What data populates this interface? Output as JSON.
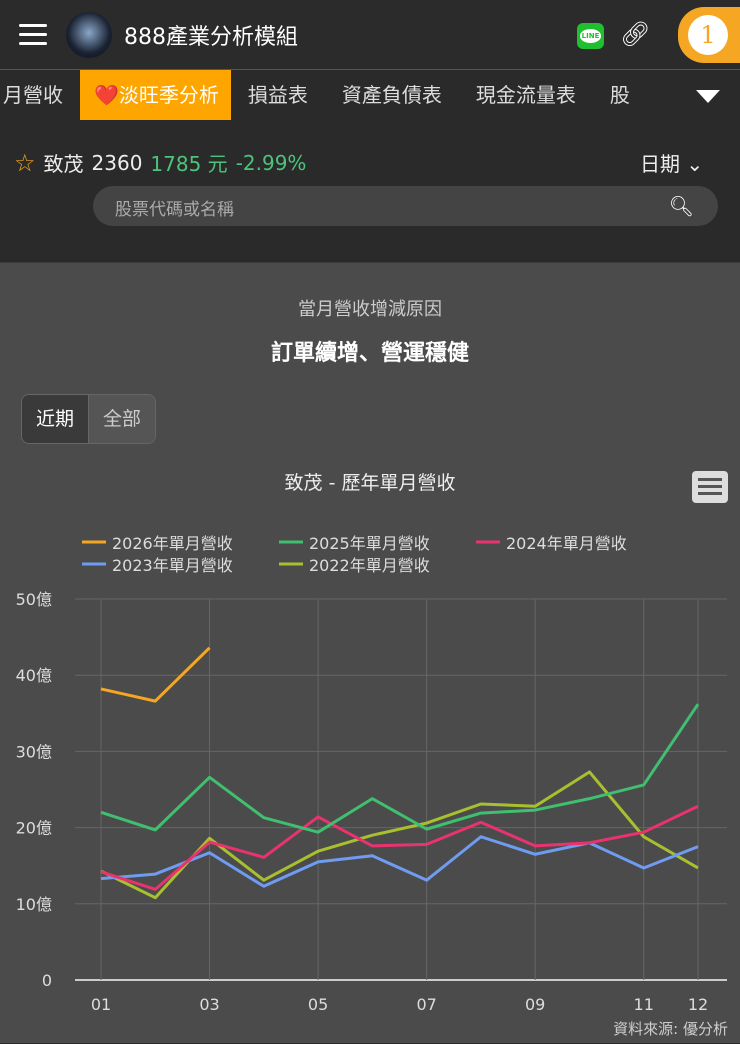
{
  "header": {
    "app_title": "888產業分析模組",
    "badge": "1",
    "line_label": "LINE"
  },
  "tabs": [
    "月營收",
    "❤️淡旺季分析",
    "損益表",
    "資產負債表",
    "現金流量表",
    "股"
  ],
  "stock": {
    "name": "致茂",
    "code": "2360",
    "price": "1785 元",
    "change": "-2.99%",
    "date_label": "日期"
  },
  "search": {
    "placeholder": "股票代碼或名稱"
  },
  "main": {
    "subtitle": "當月營收增減原因",
    "reason": "訂單續增、營運穩健",
    "toggle": [
      "近期",
      "全部"
    ],
    "source": "資料來源: 優分析"
  },
  "colors": {
    "accent": "#fea500",
    "up": "#4cc47a"
  },
  "chart_data": {
    "type": "line",
    "title": "致茂 - 歷年單月營收",
    "categories": [
      "01",
      "02",
      "03",
      "04",
      "05",
      "06",
      "07",
      "08",
      "09",
      "10",
      "11",
      "12"
    ],
    "x_tick_labels": [
      "01",
      "03",
      "05",
      "07",
      "09",
      "11",
      "12"
    ],
    "y_ticks": [
      "0",
      "10億",
      "20億",
      "30億",
      "40億",
      "50億"
    ],
    "ylim": [
      0,
      50
    ],
    "yunit": "億",
    "legend_position": "top",
    "series": [
      {
        "name": "2026年單月營收",
        "color": "#f5a623",
        "values": [
          38.2,
          36.6,
          43.6
        ]
      },
      {
        "name": "2025年單月營收",
        "color": "#3fbf6f",
        "values": [
          22.0,
          19.7,
          26.6,
          21.3,
          19.4,
          23.8,
          19.8,
          21.9,
          22.3,
          23.8,
          25.6,
          36.2
        ]
      },
      {
        "name": "2024年單月營收",
        "color": "#e8336e",
        "values": [
          14.2,
          11.9,
          18.1,
          16.1,
          21.4,
          17.6,
          17.8,
          20.7,
          17.6,
          18.0,
          19.4,
          22.8
        ]
      },
      {
        "name": "2023年單月營收",
        "color": "#6f9cf0",
        "values": [
          13.3,
          13.9,
          16.7,
          12.3,
          15.5,
          16.3,
          13.1,
          18.8,
          16.5,
          18.0,
          14.7,
          17.5
        ]
      },
      {
        "name": "2022年單月營收",
        "color": "#a8c030",
        "values": [
          14.3,
          10.8,
          18.6,
          13.1,
          16.9,
          19.0,
          20.6,
          23.1,
          22.8,
          27.3,
          18.8,
          14.7
        ]
      }
    ]
  }
}
